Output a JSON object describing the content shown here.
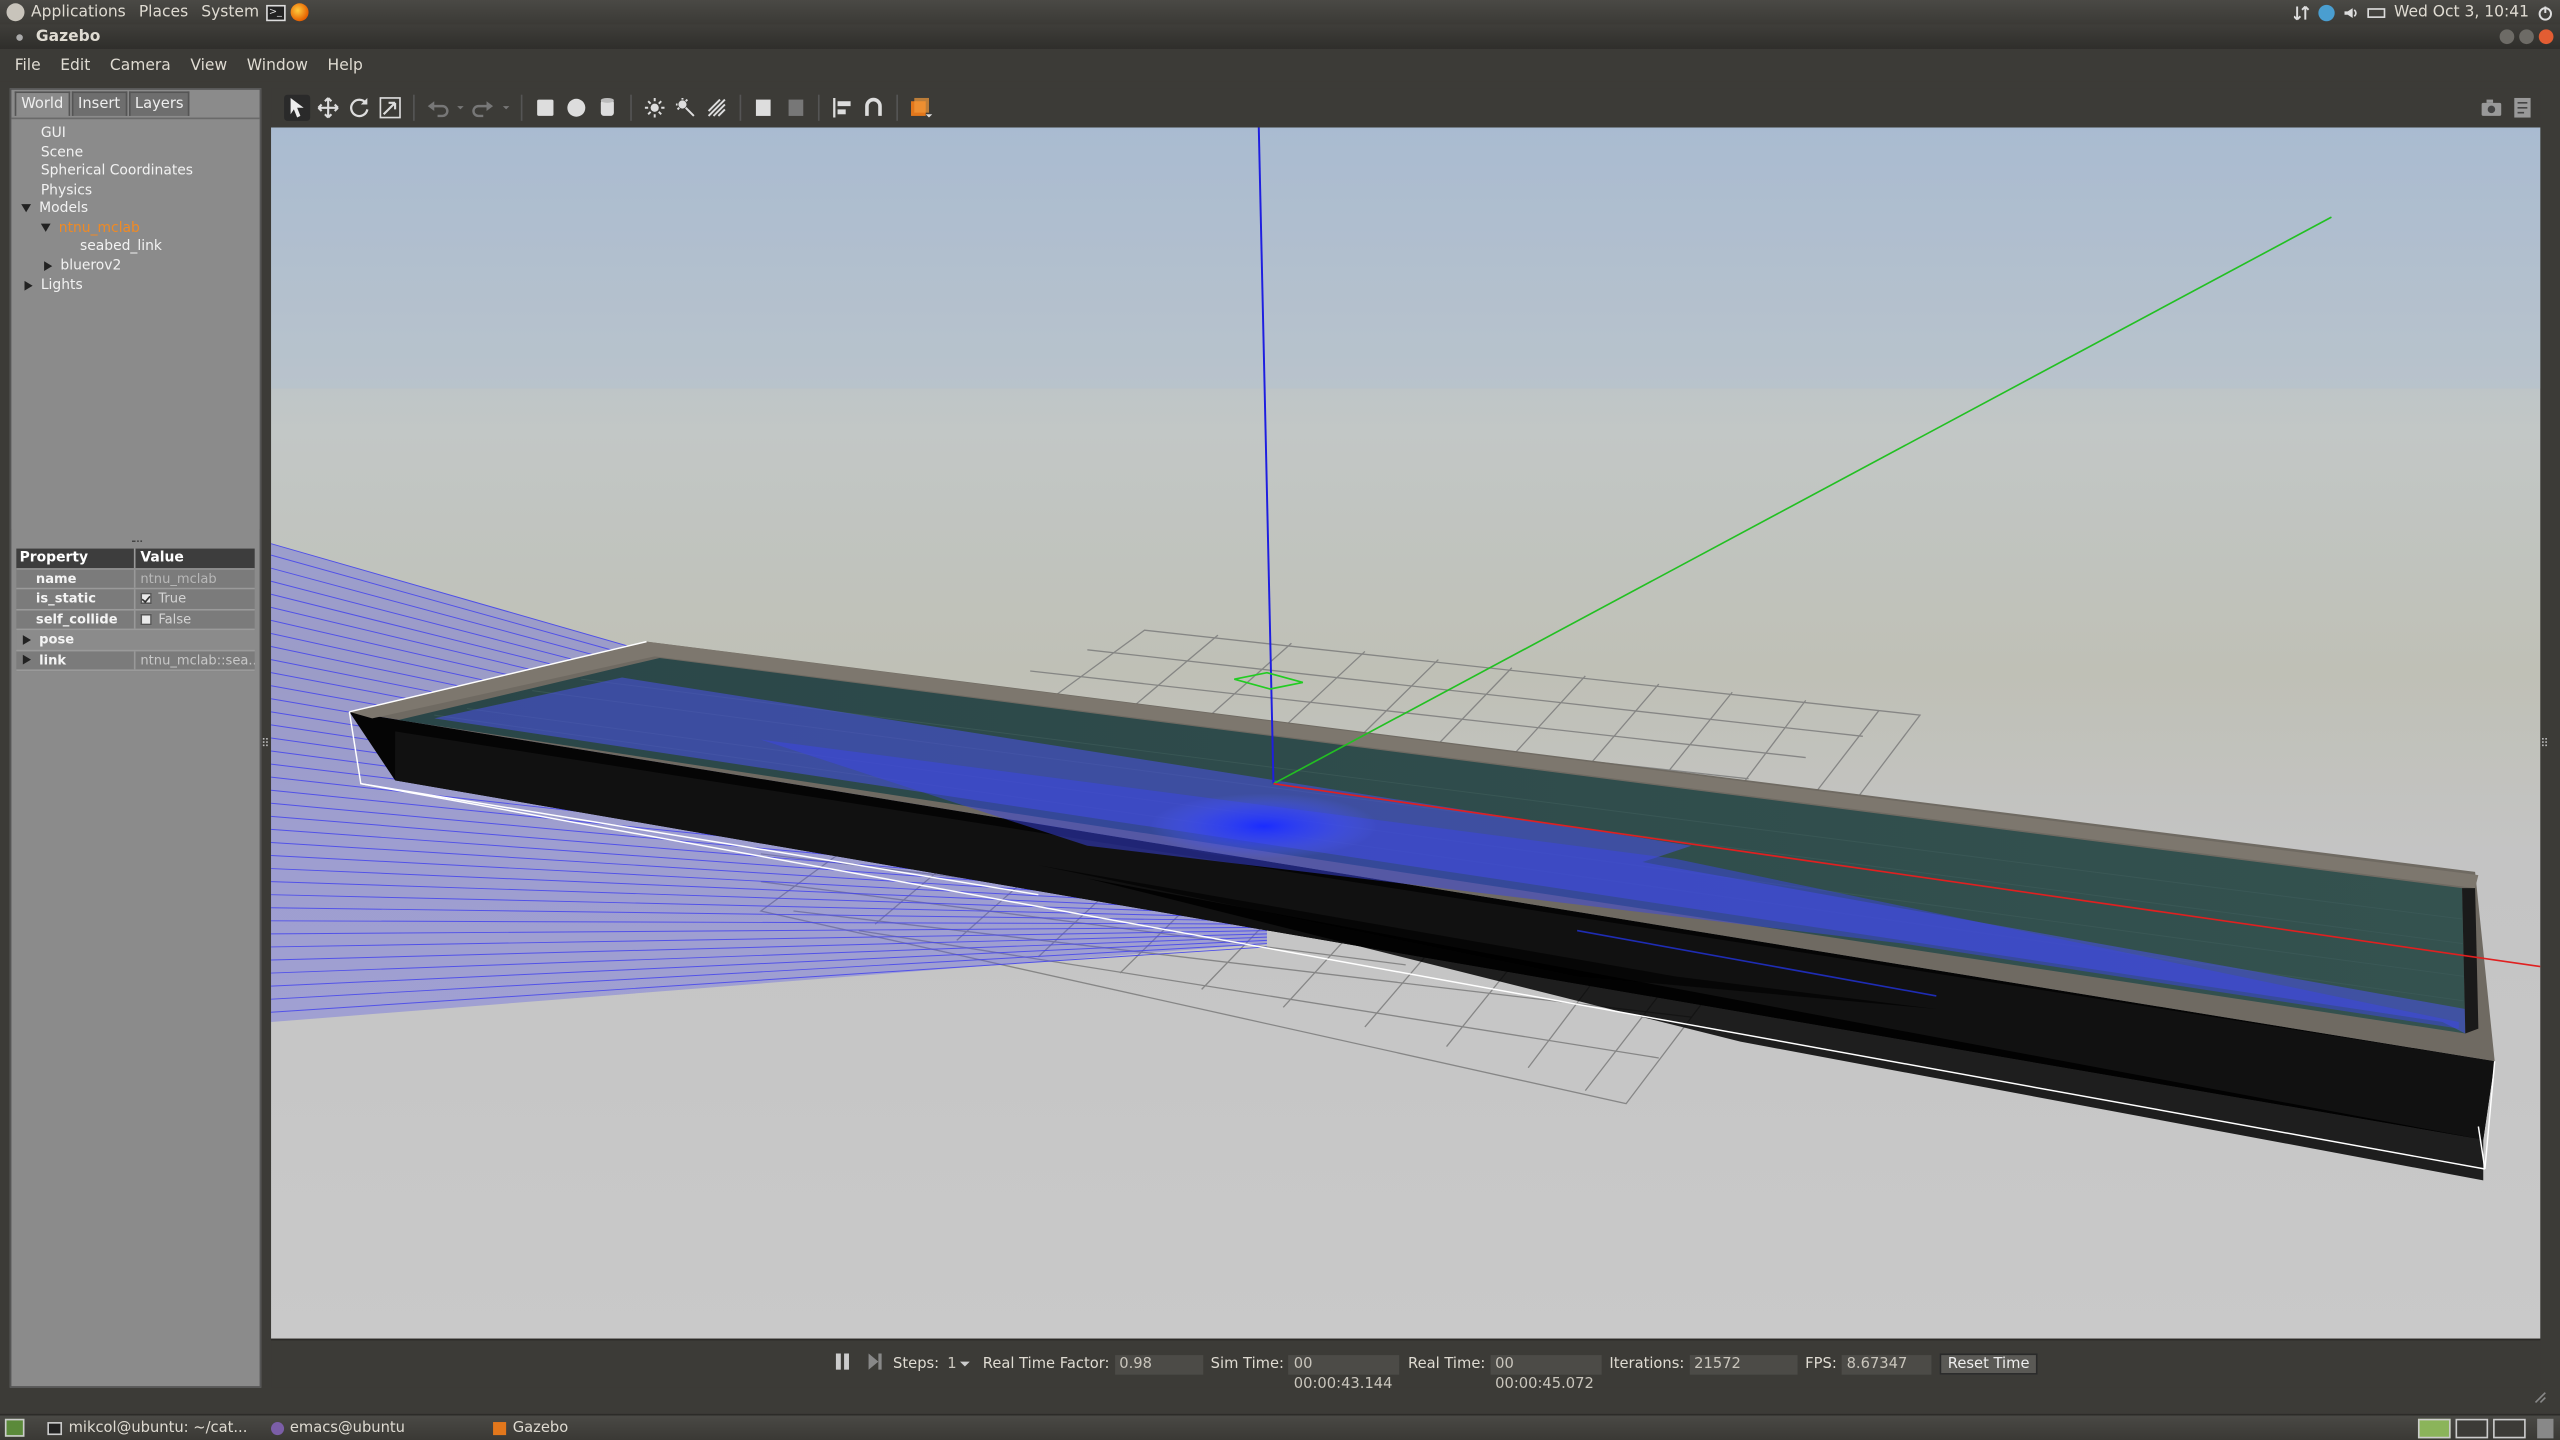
{
  "system_panel": {
    "menus": [
      "Applications",
      "Places",
      "System"
    ],
    "clock": "Wed Oct  3, 10:41"
  },
  "window": {
    "title": "Gazebo"
  },
  "menubar": [
    "File",
    "Edit",
    "Camera",
    "View",
    "Window",
    "Help"
  ],
  "left_panel": {
    "tabs": [
      "World",
      "Insert",
      "Layers"
    ],
    "active_tab": "World",
    "tree": {
      "gui": "GUI",
      "scene": "Scene",
      "spherical": "Spherical Coordinates",
      "physics": "Physics",
      "models": "Models",
      "model_selected": "ntnu_mclab",
      "seabed_link": "seabed_link",
      "bluerov": "bluerov2",
      "lights": "Lights"
    },
    "properties": {
      "header_property": "Property",
      "header_value": "Value",
      "name_label": "name",
      "name_value": "ntnu_mclab",
      "is_static_label": "is_static",
      "is_static_value": "True",
      "self_collide_label": "self_collide",
      "self_collide_value": "False",
      "pose_label": "pose",
      "link_label": "link",
      "link_value": "ntnu_mclab::sea..."
    }
  },
  "statusbar": {
    "steps_label": "Steps:",
    "steps_value": "1",
    "rtf_label": "Real Time Factor:",
    "rtf_value": "0.98",
    "sim_time_label": "Sim Time:",
    "sim_time_value": "00 00:00:43.144",
    "real_time_label": "Real Time:",
    "real_time_value": "00 00:00:45.072",
    "iterations_label": "Iterations:",
    "iterations_value": "21572",
    "fps_label": "FPS:",
    "fps_value": "8.67347",
    "reset_label": "Reset Time"
  },
  "taskbar": {
    "items": [
      "mikcol@ubuntu: ~/cat...",
      "emacs@ubuntu",
      "Gazebo"
    ]
  }
}
